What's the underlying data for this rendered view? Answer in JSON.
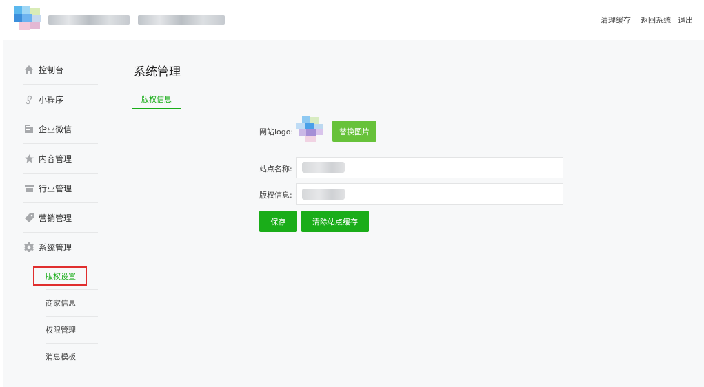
{
  "header": {
    "links": [
      "清理缓存",
      "返回系统",
      "退出"
    ]
  },
  "sidebar": {
    "items": [
      {
        "label": "控制台",
        "icon": "home-icon"
      },
      {
        "label": "小程序",
        "icon": "mini-program-icon"
      },
      {
        "label": "企业微信",
        "icon": "building-icon"
      },
      {
        "label": "内容管理",
        "icon": "star-icon"
      },
      {
        "label": "行业管理",
        "icon": "store-icon"
      },
      {
        "label": "营销管理",
        "icon": "tag-icon"
      },
      {
        "label": "系统管理",
        "icon": "gear-icon"
      }
    ],
    "sub_items": [
      {
        "label": "版权设置",
        "active": true
      },
      {
        "label": "商家信息"
      },
      {
        "label": "权限管理"
      },
      {
        "label": "消息模板"
      }
    ]
  },
  "main": {
    "title": "系统管理",
    "tabs": [
      {
        "label": "版权信息",
        "active": true
      }
    ],
    "form": {
      "logo_label": "网站logo:",
      "replace_button": "替换图片",
      "site_name_label": "站点名称:",
      "copyright_label": "版权信息:",
      "save_button": "保存",
      "clear_cache_button": "清除站点缓存"
    }
  },
  "colors": {
    "accent": "#1aad19",
    "replace_button": "#67c23a",
    "highlight_box": "#e02e2e",
    "content_bg": "#f7f8f9"
  }
}
